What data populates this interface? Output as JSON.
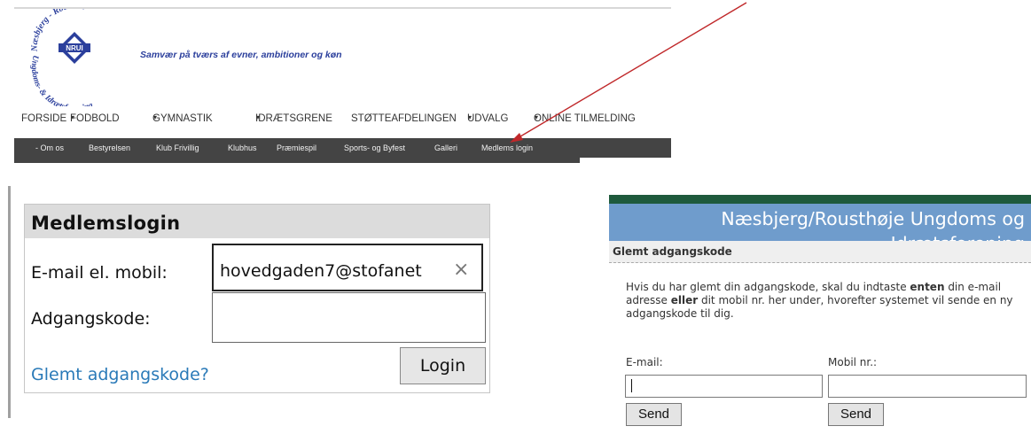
{
  "header": {
    "logo": {
      "text_top": "Næsbjerg - Rousthøje",
      "text_center": "NRUI",
      "text_bottom": "Ungdoms- & Idrætsforening"
    },
    "tagline": "Samvær på tværs af evner, ambitioner og køn",
    "main_nav": [
      {
        "label": "FORSIDE",
        "caret": ""
      },
      {
        "label": "FODBOLD",
        "caret": "▾"
      },
      {
        "label": "GYMNASTIK",
        "caret": "▾"
      },
      {
        "label": "IDRÆTSGRENE",
        "caret": "▾"
      },
      {
        "label": "STØTTEAFDELINGEN",
        "caret": ""
      },
      {
        "label": "UDVALG",
        "caret": "▾"
      },
      {
        "label": "ONLINE TILMELDING",
        "caret": "▾"
      }
    ],
    "sub_nav": [
      "- Om os",
      "Bestyrelsen",
      "Klub Frivillig",
      "Klubhus",
      "Præmiespil",
      "Sports- og Byfest",
      "Galleri",
      "Medlems login"
    ]
  },
  "login": {
    "title": "Medlemslogin",
    "email_label": "E-mail el. mobil:",
    "email_value": "hovedgaden7@stofanet",
    "clear_symbol": "×",
    "password_label": "Adgangskode:",
    "password_value": "",
    "forgot_link": "Glemt adgangskode?",
    "login_button": "Login"
  },
  "forgot": {
    "org_name_line1": "Næsbjerg/Rousthøje Ungdoms og",
    "org_name_line2": "Idrætsforening",
    "section_title": "Glemt adgangskode",
    "instructions": {
      "p1": "Hvis du har glemt din adgangskode, skal du indtaste ",
      "b1": "enten",
      "p2": " din e-mail adresse ",
      "b2": "eller",
      "p3": " dit mobil nr. her under, hvorefter systemet vil sende en ny adgangskode til dig."
    },
    "email_label": "E-mail:",
    "mobile_label": "Mobil nr.:",
    "send_label": "Send"
  },
  "colors": {
    "subnav_bg": "#444444",
    "header_blue": "#6f9ccc",
    "header_green": "#1e5a3c",
    "link_blue": "#2a7ab8",
    "arrow_red": "#c0282a"
  }
}
